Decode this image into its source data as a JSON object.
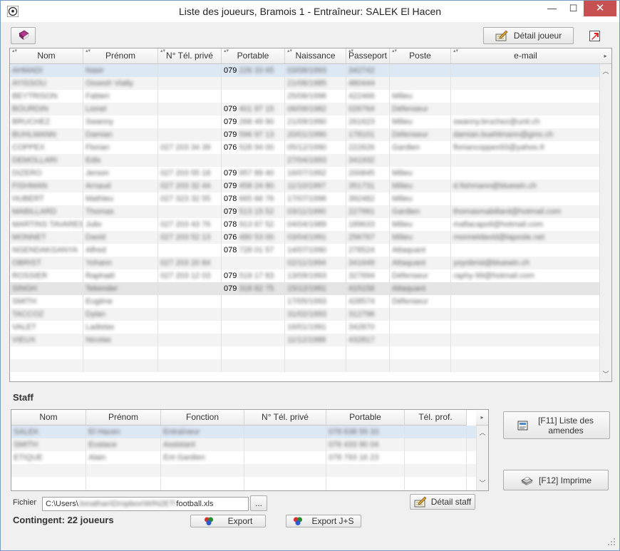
{
  "window": {
    "title": "Liste des joueurs, Bramois 1  -  Entraîneur:  SALEK El Hacen",
    "minimize": "—",
    "maximize": "☐",
    "close": "✕"
  },
  "toolbar": {
    "detail_joueur": "Détail joueur"
  },
  "players": {
    "columns": [
      "Nom",
      "Prénom",
      "N° Tél. privé",
      "Portable",
      "Naissance",
      "Passeport",
      "Poste",
      "e-mail"
    ],
    "rows": [
      [
        "AHMADI",
        "Nasir",
        "",
        "079 226 33 65",
        "03/08/1993",
        "342742",
        "",
        ""
      ],
      [
        "AYISSOU",
        "Ossesh Vialty",
        "",
        "",
        "21/08/1985",
        "480444",
        "",
        ""
      ],
      [
        "BEYTRISON",
        "Fabien",
        "",
        "",
        "25/08/1996",
        "422466",
        "Milieu",
        ""
      ],
      [
        "BOURDIN",
        "Lionel",
        "",
        "079 401 97 15",
        "06/09/1982",
        "026764",
        "Défenseur",
        ""
      ],
      [
        "BRUCHEZ",
        "Swanny",
        "",
        "079 268 49 90",
        "21/09/1990",
        "261623",
        "Milieu",
        "swanny.bruchez@unil.ch"
      ],
      [
        "BUHLMANN",
        "Damian",
        "",
        "079 596 97 13",
        "20/01/1990",
        "178101",
        "Défenseur",
        "damian.buehlmann@gmx.ch"
      ],
      [
        "COPPEX",
        "Florian",
        "027 203 34 39",
        "076 528 94 00",
        "05/12/1990",
        "222626",
        "Gardien",
        "floriancoppex93@yahoo.fr"
      ],
      [
        "DEMOLLARI",
        "Edis",
        "",
        "",
        "27/04/1993",
        "341932",
        "",
        ""
      ],
      [
        "DIZERO",
        "Jerson",
        "027 203 55 18",
        "079 957 89 40",
        "16/07/1992",
        "200845",
        "Milieu",
        ""
      ],
      [
        "FISHMAN",
        "Arnaud",
        "027 203 32 44",
        "079 458 24 80",
        "11/10/1997",
        "351731",
        "Milieu",
        "d.fishmann@bluewin.ch"
      ],
      [
        "HUBERT",
        "Mathieu",
        "027 323 32 55",
        "078 665 66 76",
        "17/07/1996",
        "392482",
        "Milieu",
        ""
      ],
      [
        "MABILLARD",
        "Thomas",
        "",
        "079 513 15 52",
        "03/11/1990",
        "227991",
        "Gardien",
        "thomasmabillard@hotmail.com"
      ],
      [
        "MARTINS TAVARES",
        "Julio",
        "027 203 43 76",
        "078 913 67 52",
        "04/04/1989",
        "189633",
        "Milieu",
        "mafiacapoll@hotmail.com"
      ],
      [
        "MONNET",
        "David",
        "027 203 52 13",
        "076 480 53 00",
        "03/04/1991",
        "256767",
        "Milieu",
        "monnetdavid@laposte.net"
      ],
      [
        "NGENDAKGANYA",
        "Alfred",
        "",
        "078 728 01 57",
        "14/07/1990",
        "278524",
        "Attaquant",
        ""
      ],
      [
        "OBRIST",
        "Yohann",
        "027 203 20 84",
        "",
        "02/11/1994",
        "341649",
        "Attaquant",
        "yoyobrist@bluewin.ch"
      ],
      [
        "ROSSIER",
        "Raphaël",
        "027 203 12 03",
        "079 519 17 83",
        "13/09/1993",
        "327694",
        "Défenseur",
        "raphy-99@hotmail.com"
      ],
      [
        "SINGH",
        "Tekender",
        "",
        "079 318 82 75",
        "15/12/1991",
        "415156",
        "Attaquant",
        ""
      ],
      [
        "SMITH",
        "Eugène",
        "",
        "",
        "17/05/1993",
        "428574",
        "Défenseur",
        ""
      ],
      [
        "TACCOZ",
        "Dylan",
        "",
        "",
        "31/02/1993",
        "312796",
        "",
        ""
      ],
      [
        "VALET",
        "Ladislas",
        "",
        "",
        "16/01/1991",
        "342870",
        "",
        ""
      ],
      [
        "VIEUX",
        "Nicolas",
        "",
        "",
        "11/12/1988",
        "432817",
        "",
        ""
      ]
    ]
  },
  "staff": {
    "label": "Staff",
    "columns": [
      "Nom",
      "Prénom",
      "Fonction",
      "N° Tél. privé",
      "Portable",
      "Tél. prof."
    ],
    "rows": [
      [
        "SALEK",
        "El Hacen",
        "Entraîneur",
        "",
        "078 638 59 33",
        ""
      ],
      [
        "SMITH",
        "Eustace",
        "Assistant",
        "",
        "076 433 90 04",
        ""
      ],
      [
        "ETIQUE",
        "Alain",
        "Ent Gardien",
        "",
        "078 793 16 23",
        ""
      ]
    ]
  },
  "buttons": {
    "amendes": "[F11] Liste des amendes",
    "imprime": "[F12] Imprime",
    "detail_staff": "Détail staff",
    "export": "Export",
    "export_js": "Export J+S",
    "browse": "..."
  },
  "file": {
    "label": "Fichier",
    "prefix": "C:\\Users\\",
    "hidden_path": "Jonathan\\Dropbox\\WIN2ET\\",
    "suffix": "football.xls"
  },
  "contingent": "Contingent: 22 joueurs"
}
